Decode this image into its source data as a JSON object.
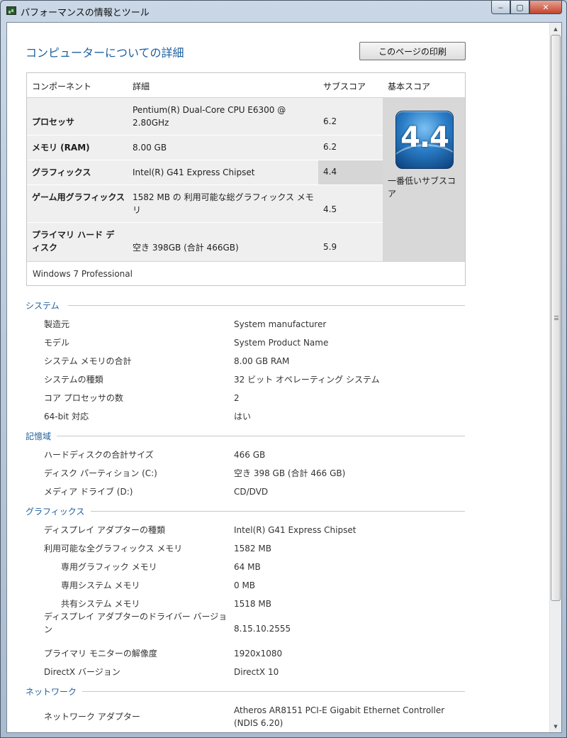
{
  "window": {
    "title": "パフォーマンスの情報とツール",
    "min_glyph": "‒",
    "max_glyph": "▢",
    "close_glyph": "✕"
  },
  "scrollbar": {
    "up_glyph": "▲",
    "down_glyph": "▼"
  },
  "page_title": "コンピューターについての詳細",
  "print_button": "このページの印刷",
  "score_table": {
    "headers": {
      "component": "コンポーネント",
      "details": "詳細",
      "subscore": "サブスコア",
      "basescore": "基本スコア"
    },
    "rows": [
      {
        "component": "プロセッサ",
        "details": "Pentium(R) Dual-Core CPU E6300 @ 2.80GHz",
        "subscore": "6.2"
      },
      {
        "component": "メモリ (RAM)",
        "details": "8.00 GB",
        "subscore": "6.2"
      },
      {
        "component": "グラフィックス",
        "details": "Intel(R) G41 Express Chipset",
        "subscore": "4.4"
      },
      {
        "component": "ゲーム用グラフィックス",
        "details": "1582 MB の 利用可能な総グラフィックス メモリ",
        "subscore": "4.5"
      },
      {
        "component": "プライマリ ハード ディスク",
        "details": "空き 398GB (合計 466GB)",
        "subscore": "5.9"
      }
    ],
    "base_score": "4.4",
    "base_score_label": "一番低いサブスコア",
    "os_edition": "Windows 7 Professional"
  },
  "sections": {
    "system": {
      "title": "システム",
      "rows": [
        {
          "label": "製造元",
          "value": "System manufacturer"
        },
        {
          "label": "モデル",
          "value": "System Product Name"
        },
        {
          "label": "システム メモリの合計",
          "value": "8.00 GB RAM"
        },
        {
          "label": "システムの種類",
          "value": "32 ビット オペレーティング システム"
        },
        {
          "label": "コア プロセッサの数",
          "value": "2"
        },
        {
          "label": "64-bit 対応",
          "value": "はい"
        }
      ]
    },
    "storage": {
      "title": "記憶域",
      "rows": [
        {
          "label": "ハードディスクの合計サイズ",
          "value": "466 GB"
        },
        {
          "label": "ディスク パーティション (C:)",
          "value": "空き 398 GB (合計 466 GB)"
        },
        {
          "label": "メディア ドライブ (D:)",
          "value": "CD/DVD"
        }
      ]
    },
    "graphics": {
      "title": "グラフィックス",
      "rows": [
        {
          "label": "ディスプレイ アダプターの種類",
          "value": "Intel(R) G41 Express Chipset"
        },
        {
          "label": "利用可能な全グラフィックス メモリ",
          "value": "1582 MB"
        },
        {
          "label": "専用グラフィック メモリ",
          "value": "64 MB"
        },
        {
          "label": "専用システム メモリ",
          "value": "0 MB"
        },
        {
          "label": "共有システム メモリ",
          "value": "1518 MB"
        },
        {
          "label": "ディスプレイ アダプターのドライバー バージョン",
          "value": "8.15.10.2555"
        },
        {
          "label": "プライマリ モニターの解像度",
          "value": "1920x1080"
        },
        {
          "label": "DirectX バージョン",
          "value": "DirectX 10"
        }
      ]
    },
    "network": {
      "title": "ネットワーク",
      "rows": [
        {
          "label": "ネットワーク アダプター",
          "value": "Atheros AR8151 PCI-E Gigabit Ethernet Controller (NDIS 6.20)"
        }
      ]
    }
  }
}
